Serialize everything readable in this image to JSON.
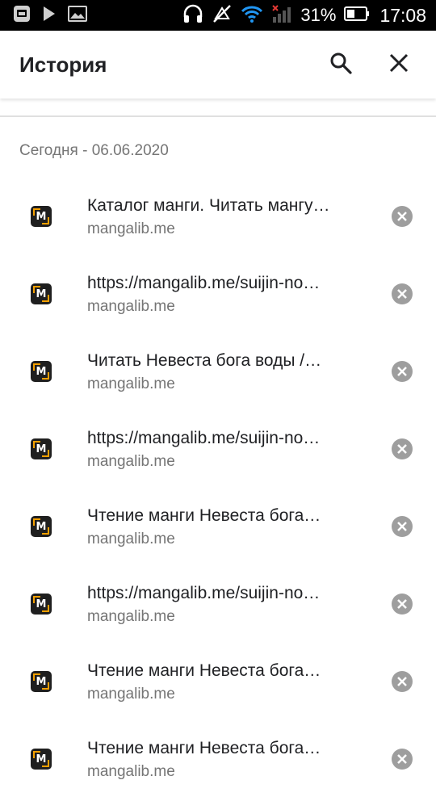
{
  "status_bar": {
    "battery_percent": "31%",
    "time": "17:08",
    "icons": [
      "notification-square-icon",
      "play-icon",
      "image-icon",
      "headphones-icon",
      "mute-icon",
      "wifi-icon",
      "signal-icon",
      "battery-icon"
    ]
  },
  "app_bar": {
    "title": "История",
    "search_icon": "search-icon",
    "close_icon": "close-icon"
  },
  "section": {
    "header": "Сегодня - 06.06.2020"
  },
  "history": [
    {
      "title": "Каталог манги. Читать мангу…",
      "url": "mangalib.me"
    },
    {
      "title": "https://mangalib.me/suijin-no…",
      "url": "mangalib.me"
    },
    {
      "title": "Читать Невеста бога воды /…",
      "url": "mangalib.me"
    },
    {
      "title": "https://mangalib.me/suijin-no…",
      "url": "mangalib.me"
    },
    {
      "title": "Чтение манги Невеста бога…",
      "url": "mangalib.me"
    },
    {
      "title": "https://mangalib.me/suijin-no…",
      "url": "mangalib.me"
    },
    {
      "title": "Чтение манги Невеста бога…",
      "url": "mangalib.me"
    },
    {
      "title": "Чтение манги Невеста бога…",
      "url": "mangalib.me"
    }
  ],
  "favicon_letter": "M",
  "colors": {
    "favicon_bg": "#1f1f1f",
    "favicon_accent": "#f5a000",
    "remove_button": "#9e9e9e",
    "title_text": "#202124",
    "secondary_text": "#757575"
  }
}
